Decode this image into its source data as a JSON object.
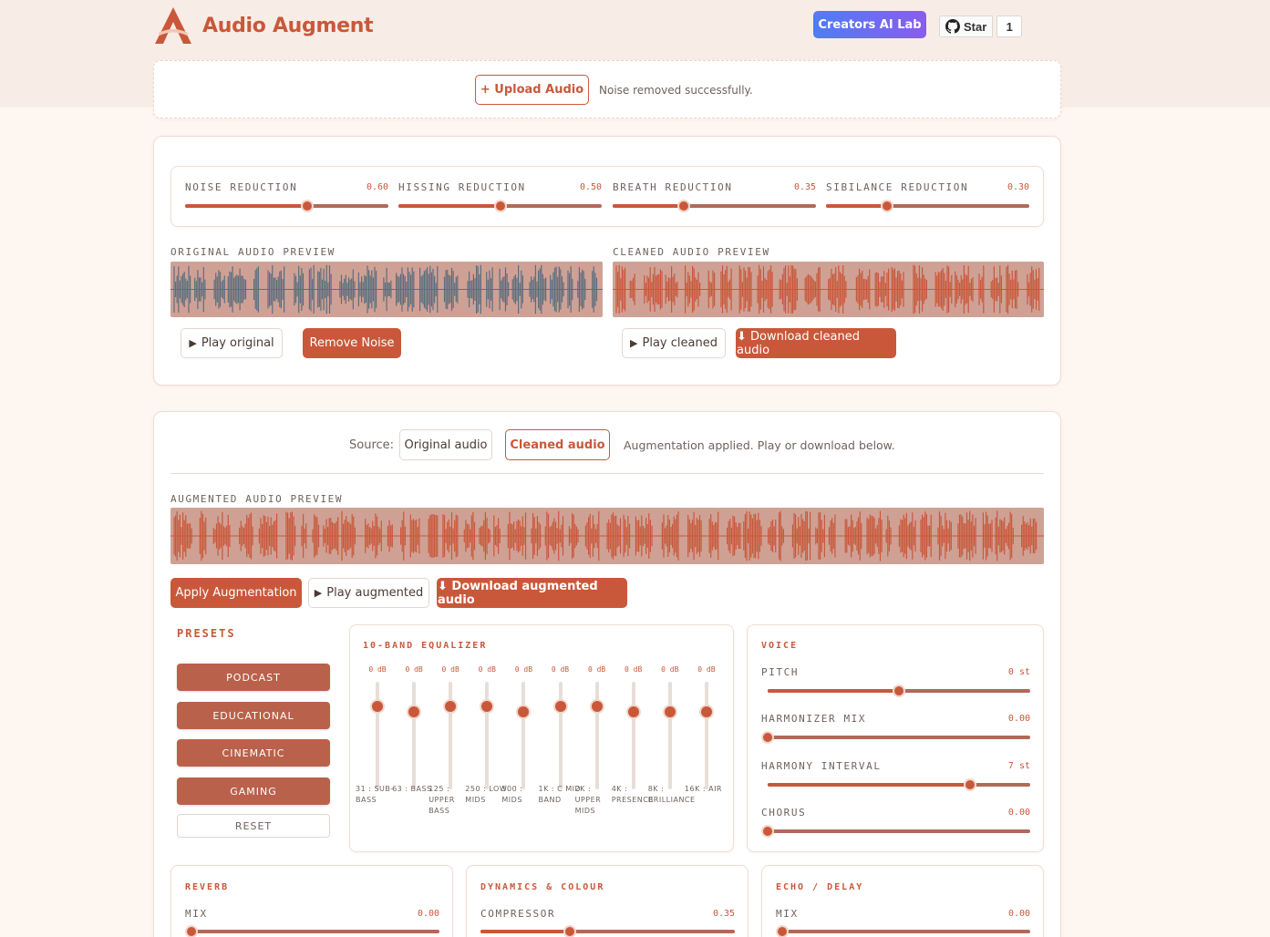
{
  "header": {
    "title": "Audio Augment",
    "creators_label": "Creators AI Lab",
    "github_star_label": "Star",
    "github_star_count": "1"
  },
  "upload": {
    "button_label": "+ Upload Audio",
    "status": "Noise removed successfully."
  },
  "noise_panel": {
    "sliders": [
      {
        "label": "NOISE REDUCTION",
        "value": "0.60",
        "fraction": 0.6
      },
      {
        "label": "HISSING REDUCTION",
        "value": "0.50",
        "fraction": 0.5
      },
      {
        "label": "BREATH REDUCTION",
        "value": "0.35",
        "fraction": 0.35
      },
      {
        "label": "SIBILANCE REDUCTION",
        "value": "0.30",
        "fraction": 0.3
      }
    ],
    "original_preview_label": "ORIGINAL AUDIO PREVIEW",
    "cleaned_preview_label": "CLEANED AUDIO PREVIEW",
    "play_original_label": "Play original",
    "remove_noise_label": "Remove Noise",
    "play_cleaned_label": "Play cleaned",
    "download_cleaned_label": "⬇ Download cleaned audio"
  },
  "augment_panel": {
    "source_label": "Source:",
    "source_original_label": "Original audio",
    "source_cleaned_label": "Cleaned audio",
    "status": "Augmentation applied. Play or download below.",
    "augmented_preview_label": "AUGMENTED AUDIO PREVIEW",
    "apply_label": "Apply Augmentation",
    "play_augmented_label": "Play augmented",
    "download_augmented_label": "⬇ Download augmented audio"
  },
  "presets": {
    "title": "PRESETS",
    "items": [
      "PODCAST",
      "EDUCATIONAL",
      "CINEMATIC",
      "GAMING"
    ],
    "reset_label": "RESET"
  },
  "equalizer": {
    "title": "10-BAND EQUALIZER",
    "bands": [
      {
        "db": "0 dB",
        "label": "31 : SUB-BASS",
        "level": 0.45
      },
      {
        "db": "0 dB",
        "label": "63 : BASS",
        "level": 0.4
      },
      {
        "db": "0 dB",
        "label": "125 : UPPER BASS",
        "level": 0.45
      },
      {
        "db": "0 dB",
        "label": "250 : LOW MIDS",
        "level": 0.45
      },
      {
        "db": "0 dB",
        "label": "500 : MIDS",
        "level": 0.4
      },
      {
        "db": "0 dB",
        "label": "1K : C MID BAND",
        "level": 0.45
      },
      {
        "db": "0 dB",
        "label": "2K : UPPER MIDS",
        "level": 0.45
      },
      {
        "db": "0 dB",
        "label": "4K : PRESENCE",
        "level": 0.4
      },
      {
        "db": "0 dB",
        "label": "8K : BRILLIANCE",
        "level": 0.4
      },
      {
        "db": "0 dB",
        "label": "16K : AIR",
        "level": 0.4
      }
    ]
  },
  "voice": {
    "title": "VOICE",
    "sliders": [
      {
        "label": "PITCH",
        "value": "0 st",
        "fraction": 0.5
      },
      {
        "label": "HARMONIZER MIX",
        "value": "0.00",
        "fraction": 0.0
      },
      {
        "label": "HARMONY INTERVAL",
        "value": "7 st",
        "fraction": 0.77
      },
      {
        "label": "CHORUS",
        "value": "0.00",
        "fraction": 0.0
      }
    ]
  },
  "reverb": {
    "title": "REVERB",
    "mix_label": "MIX",
    "mix_value": "0.00",
    "fraction": 0.0
  },
  "dynamics": {
    "title": "DYNAMICS & COLOUR",
    "compressor_label": "COMPRESSOR",
    "compressor_value": "0.35",
    "fraction": 0.35
  },
  "echo": {
    "title": "ECHO / DELAY",
    "mix_label": "MIX",
    "mix_value": "0.00",
    "fraction": 0.0
  },
  "colors": {
    "accent": "#c9583a",
    "original_wave": "#5c6e7e",
    "wave_bg": "#cfa195"
  }
}
